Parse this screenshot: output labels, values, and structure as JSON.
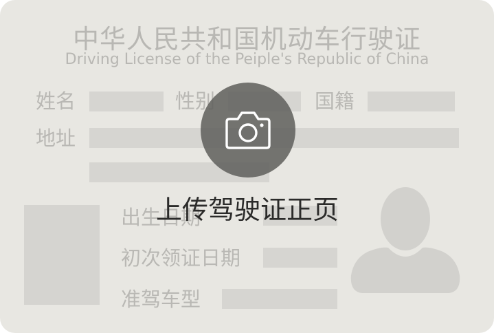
{
  "card": {
    "title_cn": "中华人民共和国机动车行驶证",
    "title_en": "Driving License of the Peiple's Republic of China",
    "fields": {
      "name": "姓名",
      "sex": "性别",
      "nationality": "国籍",
      "address": "地址",
      "birth_date": "出生日期",
      "first_issue_date": "初次领证日期",
      "vehicle_class": "准驾车型"
    }
  },
  "upload": {
    "icon": "camera-icon",
    "label": "上传驾驶证正页"
  },
  "colors": {
    "card_bg": "#e8e7e2",
    "placeholder": "#d6d5d1",
    "label_text": "#b9b8b4",
    "overlay": "#5f5f5c"
  }
}
